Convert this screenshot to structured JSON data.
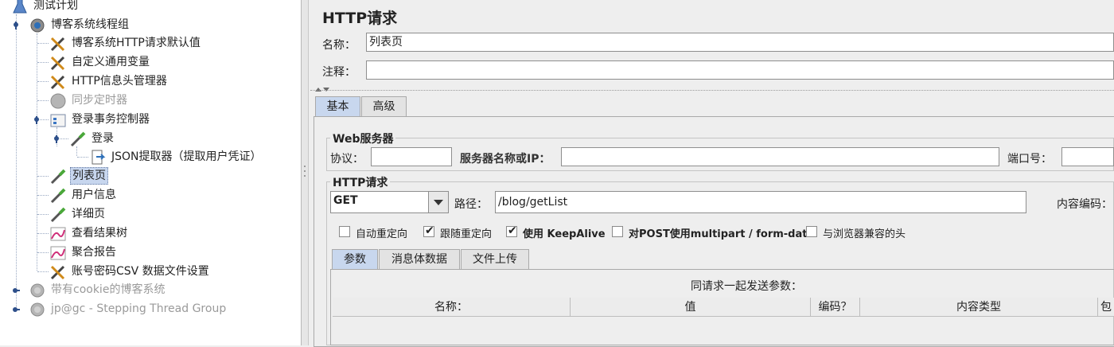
{
  "tree": {
    "test_plan": "测试计划",
    "thread_group": "博客系统线程组",
    "http_defaults": "博客系统HTTP请求默认值",
    "user_vars": "自定义通用变量",
    "header_mgr": "HTTP信息头管理器",
    "sync_timer": "同步定时器",
    "login_tx": "登录事务控制器",
    "login": "登录",
    "json_extractor": "JSON提取器（提取用户凭证）",
    "list_page": "列表页",
    "user_info": "用户信息",
    "detail_page": "详细页",
    "results_tree": "查看结果树",
    "agg_report": "聚合报告",
    "csv_config": "账号密码CSV 数据文件设置",
    "cookie_group": "带有cookie的博客系统",
    "stepping_group": "jp@gc - Stepping Thread Group"
  },
  "panel": {
    "title": "HTTP请求",
    "name_label": "名称：",
    "name_value": "列表页",
    "comment_label": "注释：",
    "comment_value": "",
    "tabs": [
      "基本",
      "高级"
    ],
    "web_server": {
      "title": "Web服务器",
      "protocol_label": "协议：",
      "protocol_value": "",
      "server_label": "服务器名称或IP：",
      "server_value": "",
      "port_label": "端口号：",
      "port_value": ""
    },
    "http_request": {
      "title": "HTTP请求",
      "method": "GET",
      "path_label": "路径：",
      "path_value": "/blog/getList",
      "encoding_label": "内容编码："
    },
    "checkboxes": [
      {
        "label": "自动重定向",
        "checked": false
      },
      {
        "label": "跟随重定向",
        "checked": true
      },
      {
        "label": "使用 KeepAlive",
        "checked": true
      },
      {
        "label": "对POST使用multipart / form-data",
        "checked": false
      },
      {
        "label": "与浏览器兼容的头",
        "checked": false
      }
    ],
    "sub_tabs": [
      "参数",
      "消息体数据",
      "文件上传"
    ],
    "params_caption": "同请求一起发送参数：",
    "columns": [
      "名称：",
      "值",
      "编码？",
      "内容类型",
      "包"
    ]
  }
}
